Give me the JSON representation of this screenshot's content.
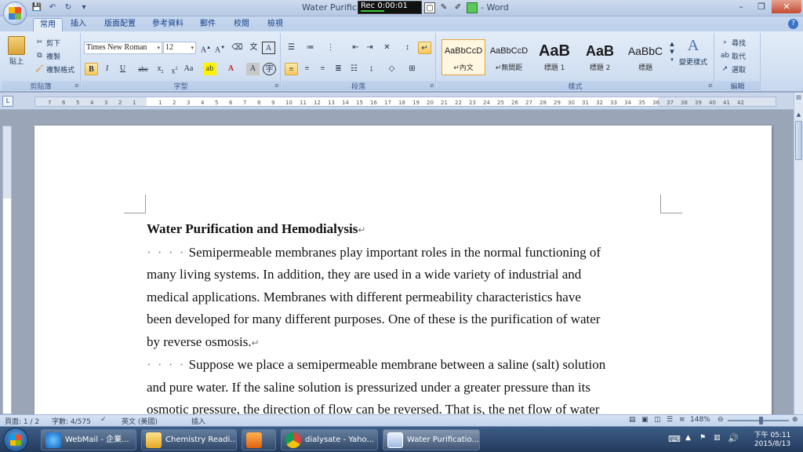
{
  "window": {
    "title_left": "Water Purificatio",
    "title_right": "- Word",
    "rec_time": "Rec 0:00:01"
  },
  "tabs": [
    "常用",
    "插入",
    "版面配置",
    "參考資料",
    "郵件",
    "校閱",
    "檢視"
  ],
  "ribbon": {
    "clipboard": {
      "paste": "貼上",
      "cut": "剪下",
      "copy": "複製",
      "format_painter": "複製格式",
      "label": "剪貼簿"
    },
    "font": {
      "family": "Times New Roman",
      "size": "12",
      "label": "字型"
    },
    "paragraph": {
      "label": "段落"
    },
    "styles": {
      "label": "樣式",
      "items": [
        {
          "sample": "AaBbCcD",
          "name": "↵內文"
        },
        {
          "sample": "AaBbCcD",
          "name": "↵無間距"
        },
        {
          "sample": "AaB",
          "name": "標題 1"
        },
        {
          "sample": "AaB",
          "name": "標題 2"
        },
        {
          "sample": "AaBbC",
          "name": "標題"
        }
      ],
      "change": "變更樣式"
    },
    "editing": {
      "find": "尋找",
      "replace": "取代",
      "select": "選取",
      "label": "編輯"
    }
  },
  "ruler_ticks": [
    "1",
    "2",
    "3",
    "4",
    "5",
    "6",
    "7",
    "8",
    "9",
    "10",
    "11",
    "12",
    "13",
    "14",
    "15",
    "16",
    "17",
    "18",
    "19",
    "20",
    "21",
    "22",
    "23",
    "24",
    "25",
    "26",
    "27",
    "28",
    "29",
    "30",
    "31",
    "32",
    "33",
    "34",
    "35",
    "36",
    "37",
    "38",
    "39",
    "40",
    "41",
    "42"
  ],
  "ruler_left_ticks": [
    "7",
    "6",
    "5",
    "4",
    "3",
    "2",
    "1"
  ],
  "document": {
    "title": "Water Purification and Hemodialysis",
    "p1_lines": [
      "Semipermeable membranes play important roles in the normal functioning of",
      "many living systems. In addition, they are used in a wide variety of industrial and",
      "medical applications. Membranes with different permeability characteristics have",
      "been developed for many different purposes. One of these is the purification of water",
      "by reverse osmosis."
    ],
    "p2_lines": [
      "Suppose we place a semipermeable membrane between a saline (salt) solution",
      "and pure water. If the saline solution is pressurized under a greater pressure than its",
      "osmotic pressure, the direction of flow can be reversed. That is, the net flow of water"
    ],
    "indent_dots": "· · · ·"
  },
  "status": {
    "page": "頁面: 1 / 2",
    "words": "字數: 4/575",
    "language": "英文 (美國)",
    "mode": "插入",
    "zoom": "148%"
  },
  "taskbar": {
    "items": [
      {
        "label": "WebMail - 企業..."
      },
      {
        "label": "Chemistry Readi..."
      },
      {
        "label": ""
      },
      {
        "label": "dialysate - Yaho..."
      },
      {
        "label": "Water Purificatio..."
      }
    ],
    "time": "下午 05:11",
    "date": "2015/8/13"
  }
}
